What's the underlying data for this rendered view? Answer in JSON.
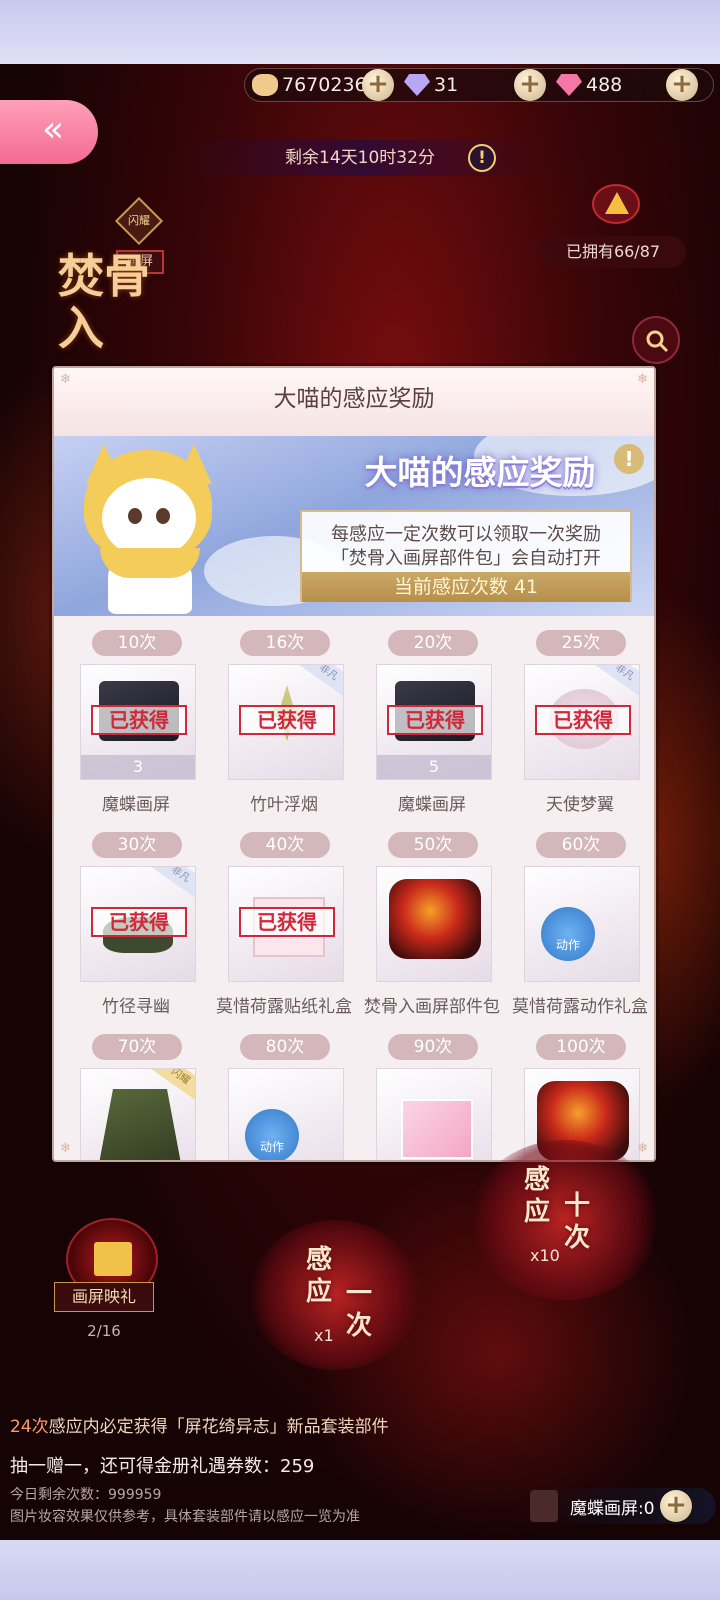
{
  "currency": {
    "coins": "7670236",
    "diamonds": "31",
    "crystals": "488",
    "plus_label": "+"
  },
  "header": {
    "back_label": "«",
    "timer_text": "剩余14天10时32分",
    "info_label": "!",
    "owned_text": "已拥有66/87",
    "badge_flash": "闪耀",
    "badge_screen": "画屏",
    "event_title": "焚骨入"
  },
  "modal": {
    "title": "大喵的感应奖励",
    "banner_title": "大喵的感应奖励",
    "banner_info": "!",
    "desc_line1": "每感应一定次数可以领取一次奖励",
    "desc_line2": "「焚骨入画屏部件包」会自动打开",
    "current_count": "当前感应次数 41",
    "claimed_label": "已获得",
    "items": [
      {
        "count": "10次",
        "name": "魔蝶画屏",
        "claimed": true,
        "qty": "3",
        "corner": "",
        "art": "dark"
      },
      {
        "count": "16次",
        "name": "竹叶浮烟",
        "claimed": true,
        "qty": "",
        "corner": "非凡",
        "art": "leaf"
      },
      {
        "count": "20次",
        "name": "魔蝶画屏",
        "claimed": true,
        "qty": "5",
        "corner": "",
        "art": "dark"
      },
      {
        "count": "25次",
        "name": "天使梦翼",
        "claimed": true,
        "qty": "",
        "corner": "非凡",
        "art": "wing"
      },
      {
        "count": "30次",
        "name": "竹径寻幽",
        "claimed": true,
        "qty": "",
        "corner": "非凡",
        "art": "shoe"
      },
      {
        "count": "40次",
        "name": "莫惜荷露贴纸礼盒",
        "claimed": true,
        "qty": "",
        "corner": "",
        "art": "box"
      },
      {
        "count": "50次",
        "name": "焚骨入画屏部件包",
        "claimed": false,
        "qty": "",
        "corner": "",
        "art": "red"
      },
      {
        "count": "60次",
        "name": "莫惜荷露动作礼盒",
        "claimed": false,
        "qty": "",
        "corner": "",
        "art": "act"
      },
      {
        "count": "70次",
        "name": "",
        "claimed": false,
        "qty": "",
        "corner": "闪耀",
        "art": "green"
      },
      {
        "count": "80次",
        "name": "",
        "claimed": false,
        "qty": "",
        "corner": "",
        "art": "act"
      },
      {
        "count": "90次",
        "name": "",
        "claimed": false,
        "qty": "",
        "corner": "",
        "art": "pink"
      },
      {
        "count": "100次",
        "name": "",
        "claimed": false,
        "qty": "",
        "corner": "",
        "art": "red"
      }
    ],
    "action_badge": "动作"
  },
  "bottom": {
    "gift_label": "画屏映礼",
    "gift_count": "2/16",
    "draw_one_a": "感应",
    "draw_one_b": "一次",
    "draw_one_mult": "x1",
    "draw_ten_a": "感应",
    "draw_ten_b": "十次",
    "draw_ten_mult": "x10",
    "line1_count": "24次",
    "line1_rest": "感应内必定获得「屏花绮异志」新品套装部件",
    "line2": "抽一赠一，还可得金册礼遇券数：259",
    "line3": "今日剩余次数：999959",
    "line4": "图片妆容效果仅供参考，具体套装部件请以感应一览为准",
    "inventory": "魔蝶画屏:0"
  },
  "colors": {
    "accent_pink": "#f36b93",
    "claimed_red": "#d0283a",
    "banner_gold": "#caa866"
  }
}
